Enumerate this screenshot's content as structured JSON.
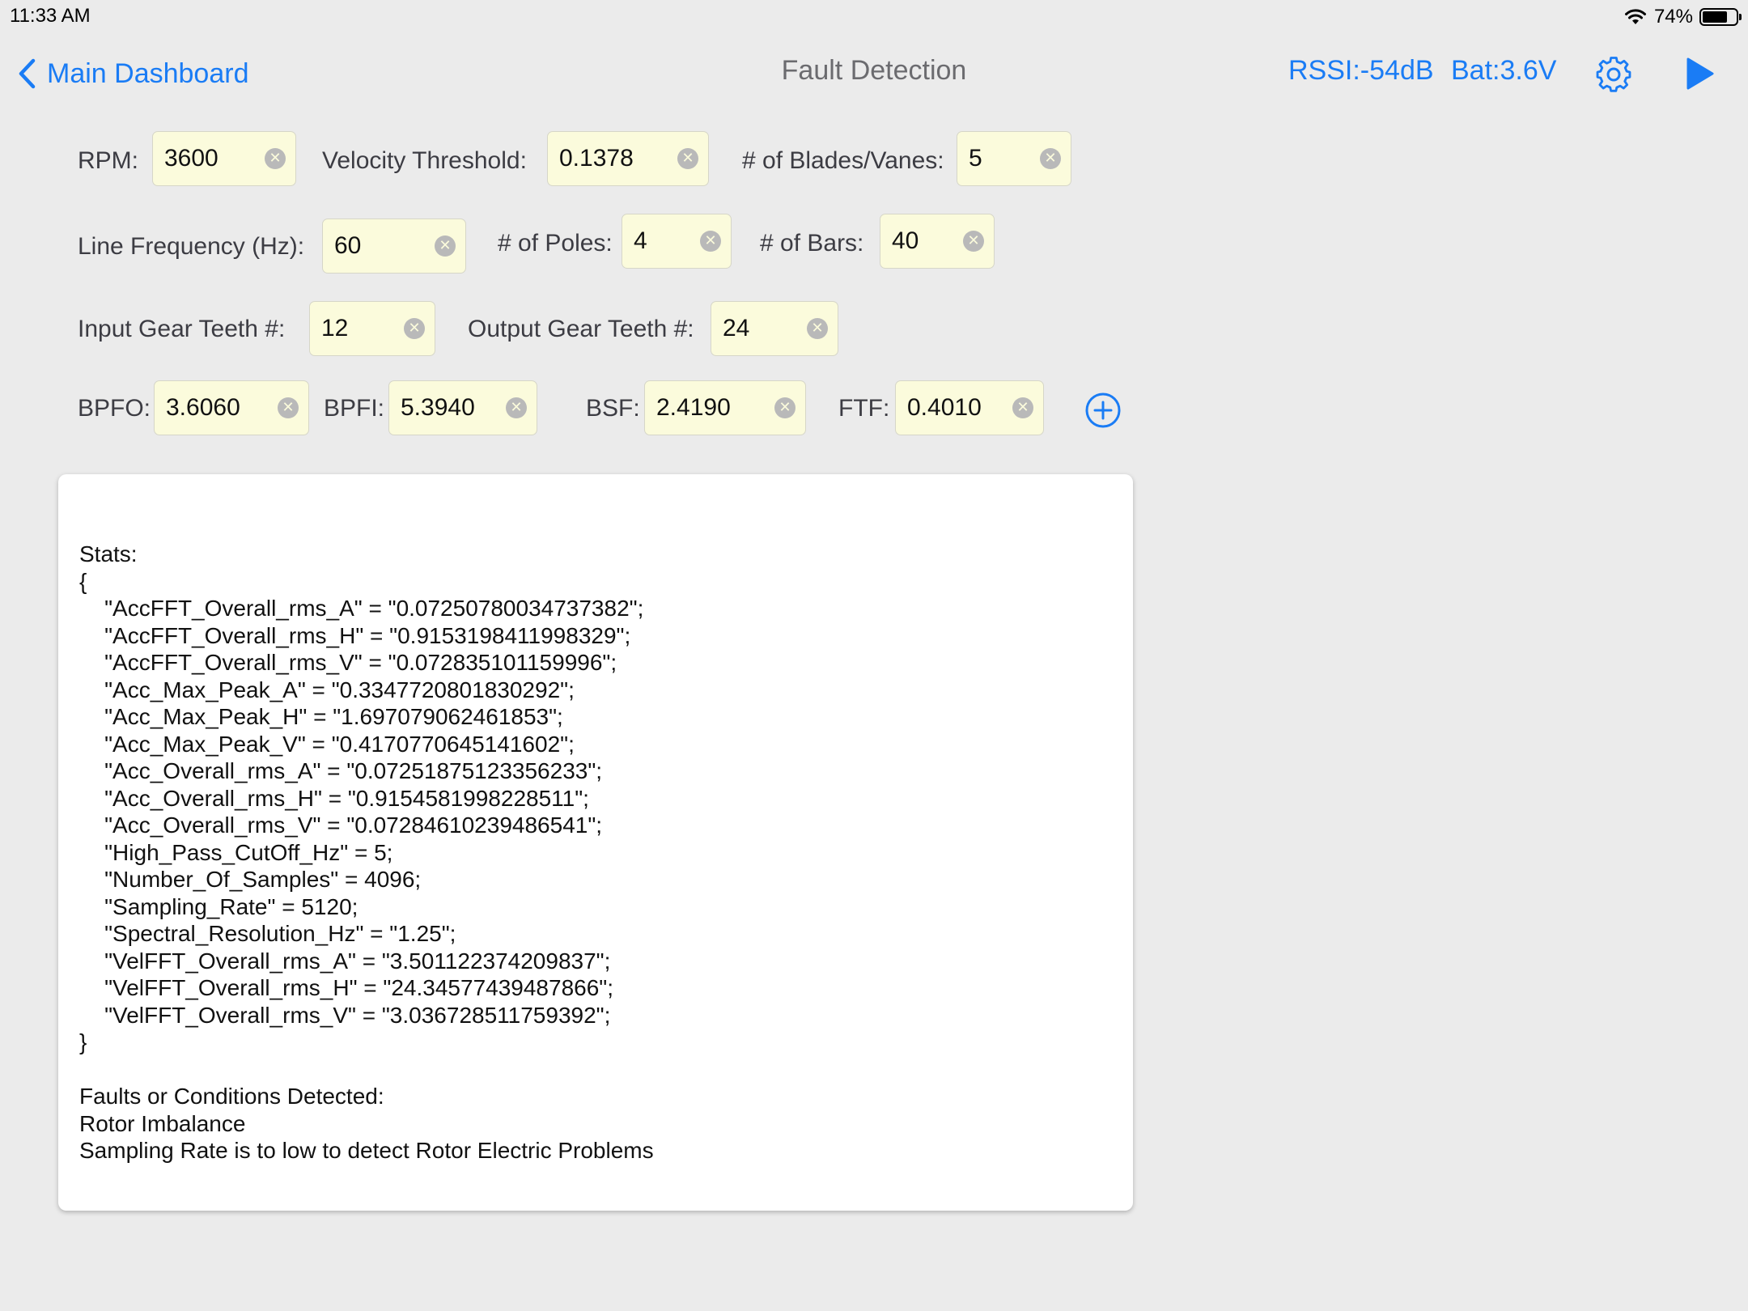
{
  "status_bar": {
    "time": "11:33 AM",
    "battery_percent": "74%",
    "battery_level": 0.74
  },
  "nav": {
    "back_label": "Main Dashboard",
    "title": "Fault Detection",
    "rssi": "RSSI:-54dB",
    "battery_voltage": "Bat:3.6V"
  },
  "colors": {
    "accent": "#1a7cf5",
    "field_bg": "#fbfbdc",
    "background": "#ebebeb"
  },
  "icons": {
    "back": "chevron-left-icon",
    "settings": "gear-icon",
    "run": "play-icon",
    "add": "plus-circle-icon",
    "clear": "clear-x-icon"
  },
  "form": {
    "rpm": {
      "label": "RPM:",
      "value": "3600"
    },
    "velocity_threshold": {
      "label": "Velocity Threshold:",
      "value": "0.1378"
    },
    "blades": {
      "label": "# of Blades/Vanes:",
      "value": "5"
    },
    "line_frequency": {
      "label": "Line Frequency (Hz):",
      "value": "60"
    },
    "poles": {
      "label": "# of Poles:",
      "value": "4"
    },
    "bars": {
      "label": "# of Bars:",
      "value": "40"
    },
    "input_gear": {
      "label": "Input Gear Teeth #:",
      "value": "12"
    },
    "output_gear": {
      "label": "Output Gear Teeth #:",
      "value": "24"
    },
    "bpfo": {
      "label": "BPFO:",
      "value": "3.6060"
    },
    "bpfi": {
      "label": "BPFI:",
      "value": "5.3940"
    },
    "bsf": {
      "label": "BSF:",
      "value": "2.4190"
    },
    "ftf": {
      "label": "FTF:",
      "value": "0.4010"
    }
  },
  "results": {
    "lines": [
      "Stats:",
      "{",
      "    \"AccFFT_Overall_rms_A\" = \"0.07250780034737382\";",
      "    \"AccFFT_Overall_rms_H\" = \"0.9153198411998329\";",
      "    \"AccFFT_Overall_rms_V\" = \"0.072835101159996\";",
      "    \"Acc_Max_Peak_A\" = \"0.3347720801830292\";",
      "    \"Acc_Max_Peak_H\" = \"1.697079062461853\";",
      "    \"Acc_Max_Peak_V\" = \"0.4170770645141602\";",
      "    \"Acc_Overall_rms_A\" = \"0.07251875123356233\";",
      "    \"Acc_Overall_rms_H\" = \"0.9154581998228511\";",
      "    \"Acc_Overall_rms_V\" = \"0.07284610239486541\";",
      "    \"High_Pass_CutOff_Hz\" = 5;",
      "    \"Number_Of_Samples\" = 4096;",
      "    \"Sampling_Rate\" = 5120;",
      "    \"Spectral_Resolution_Hz\" = \"1.25\";",
      "    \"VelFFT_Overall_rms_A\" = \"3.501122374209837\";",
      "    \"VelFFT_Overall_rms_H\" = \"24.34577439487866\";",
      "    \"VelFFT_Overall_rms_V\" = \"3.036728511759392\";",
      "}",
      "",
      "Faults or Conditions Detected:",
      "Rotor Imbalance",
      "Sampling Rate is to low to detect Rotor Electric Problems"
    ]
  }
}
